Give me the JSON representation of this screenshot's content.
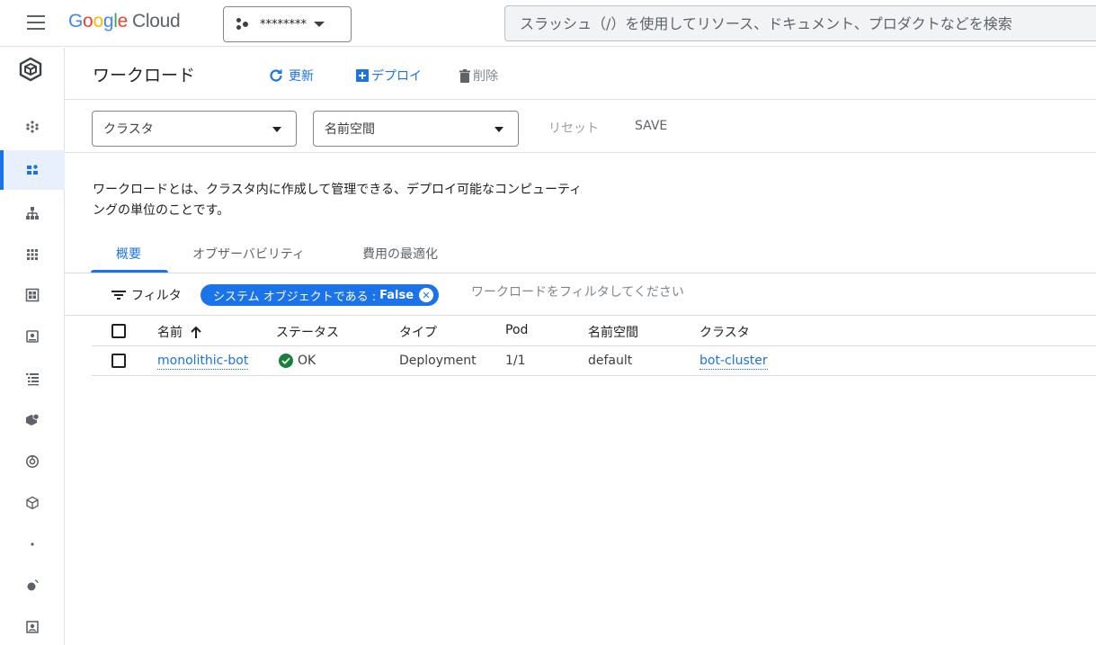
{
  "topbar": {
    "logo_letters": [
      "G",
      "o",
      "o",
      "g",
      "l",
      "e"
    ],
    "logo_suffix": "Cloud",
    "project_name": "********",
    "search_placeholder": "スラッシュ（/）を使用してリソース、ドキュメント、プロダクトなどを検索"
  },
  "rail": {
    "product_icon": "kubernetes-engine-icon",
    "items": [
      {
        "icon": "clusters-icon"
      },
      {
        "icon": "workloads-icon",
        "active": true
      },
      {
        "icon": "services-ingress-icon"
      },
      {
        "icon": "applications-icon"
      },
      {
        "icon": "secrets-configmaps-icon"
      },
      {
        "icon": "storage-icon"
      },
      {
        "icon": "object-browser-icon"
      },
      {
        "icon": "migrate-icon"
      },
      {
        "icon": "backup-icon"
      },
      {
        "icon": "config-icon"
      },
      {
        "icon": "dot-icon"
      },
      {
        "icon": "marketplace-icon"
      },
      {
        "icon": "release-notes-icon"
      }
    ]
  },
  "header": {
    "title": "ワークロード",
    "refresh_label": "更新",
    "deploy_label": "デプロイ",
    "delete_label": "削除"
  },
  "filters": {
    "cluster_label": "クラスタ",
    "namespace_label": "名前空間",
    "reset_label": "リセット",
    "save_label": "SAVE"
  },
  "description": {
    "line1": "ワークロードとは、クラスタ内に作成して管理できる、デプロイ可能なコンピューティ",
    "line2": "ングの単位のことです。"
  },
  "tabs": [
    {
      "label": "概要",
      "active": true
    },
    {
      "label": "オブザーバビリティ"
    },
    {
      "label": "費用の最適化"
    }
  ],
  "filterbar": {
    "label": "フィルタ",
    "chip_key": "システム オブジェクトである :",
    "chip_value": "False",
    "placeholder": "ワークロードをフィルタしてください"
  },
  "table": {
    "columns": [
      "名前",
      "ステータス",
      "タイプ",
      "Pod",
      "名前空間",
      "クラスタ"
    ],
    "rows": [
      {
        "name": "monolithic-bot",
        "status": "OK",
        "type": "Deployment",
        "pods": "1/1",
        "namespace": "default",
        "cluster": "bot-cluster"
      }
    ]
  },
  "colors": {
    "accent": "#1a73e8",
    "ok": "#188038"
  }
}
